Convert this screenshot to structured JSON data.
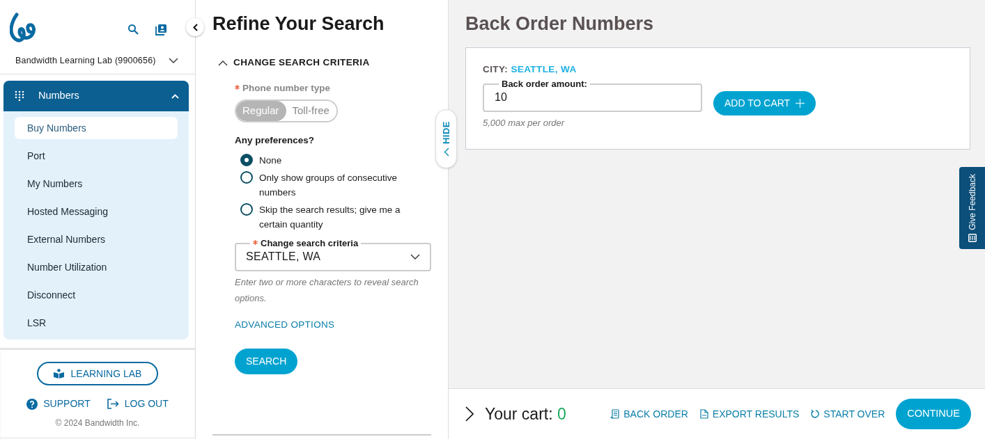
{
  "sidebar": {
    "account": "Bandwidth Learning Lab (9900656)",
    "nav": {
      "label": "Numbers",
      "expanded": true,
      "items": [
        {
          "label": "Buy Numbers",
          "selected": true
        },
        {
          "label": "Port",
          "selected": false
        },
        {
          "label": "My Numbers",
          "selected": false
        },
        {
          "label": "Hosted Messaging",
          "selected": false
        },
        {
          "label": "External Numbers",
          "selected": false
        },
        {
          "label": "Number Utilization",
          "selected": false
        },
        {
          "label": "Disconnect",
          "selected": false
        },
        {
          "label": "LSR",
          "selected": false
        }
      ]
    },
    "learning_lab_button": "LEARNING LAB",
    "support_link": "SUPPORT",
    "logout_link": "LOG OUT",
    "copyright": "© 2024 Bandwidth Inc."
  },
  "refine": {
    "title": "Refine Your Search",
    "section": {
      "title": "CHANGE SEARCH CRITERIA",
      "expanded": true
    },
    "phone_type": {
      "label": "Phone number type",
      "required": true,
      "options": [
        {
          "label": "Regular",
          "selected": true
        },
        {
          "label": "Toll-free",
          "selected": false
        }
      ]
    },
    "preferences": {
      "label": "Any preferences?",
      "options": [
        {
          "label": "None",
          "selected": true
        },
        {
          "label": "Only show groups of consecutive numbers",
          "selected": false
        },
        {
          "label": "Skip the search results; give me a certain quantity",
          "selected": false
        }
      ]
    },
    "criteria_field": {
      "label": "Change search criteria",
      "required": true,
      "value": "SEATTLE, WA"
    },
    "hint": "Enter two or more characters to reveal search options.",
    "advanced_link": "ADVANCED OPTIONS",
    "search_button": "SEARCH",
    "hide_tab": "HIDE"
  },
  "main": {
    "title": "Back Order Numbers",
    "card": {
      "city_label": "CITY:",
      "city_value": "SEATTLE, WA",
      "amount_label": "Back order amount:",
      "amount_value": "10",
      "help": "5,000 max per order",
      "add_button": "ADD TO CART"
    },
    "feedback_tab": "Give Feedback"
  },
  "cart_bar": {
    "label": "Your cart:",
    "count": "0",
    "actions": [
      {
        "label": "BACK ORDER",
        "kind": "backorder"
      },
      {
        "label": "EXPORT RESULTS",
        "kind": "export"
      },
      {
        "label": "START OVER",
        "kind": "restart"
      }
    ],
    "continue_button": "CONTINUE"
  }
}
